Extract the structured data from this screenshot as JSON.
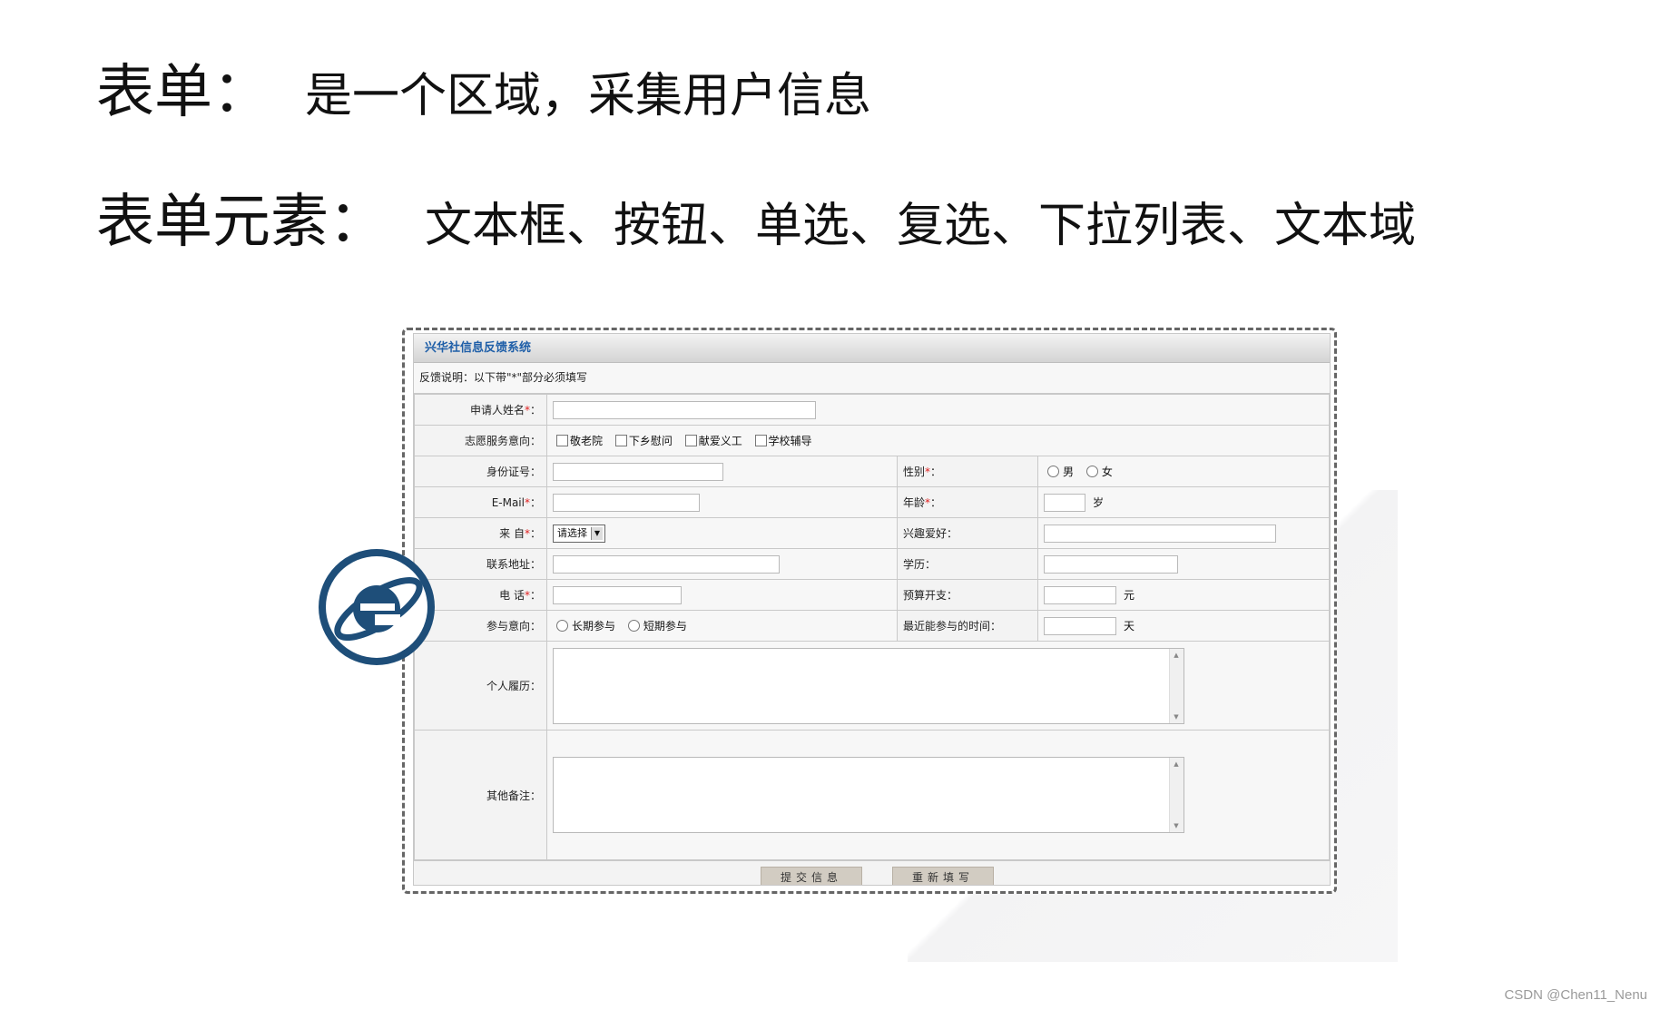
{
  "slide": {
    "line1": {
      "label": "表单：",
      "text": "是一个区域，采集用户信息"
    },
    "line2": {
      "label": "表单元素：",
      "text": "文本框、按钮、单选、复选、下拉列表、文本域"
    },
    "credit": "CSDN @Chen11_Nenu"
  },
  "form": {
    "title": "兴华社信息反馈系统",
    "note": "反馈说明：以下带\"*\"部分必须填写",
    "required_mark": "*",
    "applicant_label": "申请人姓名",
    "volunteer_label": "志愿服务意向",
    "volunteer_options": [
      "敬老院",
      "下乡慰问",
      "献爱义工",
      "学校辅导"
    ],
    "id_label": "身份证号",
    "gender_label": "性别",
    "gender_options": [
      "男",
      "女"
    ],
    "email_label": "E-Mail",
    "age_label": "年龄",
    "age_unit": "岁",
    "from_label": "来 自",
    "from_select": "请选择",
    "hobby_label": "兴趣爱好",
    "address_label": "联系地址",
    "edu_label": "学历",
    "phone_label": "电 话",
    "budget_label": "预算开支",
    "budget_unit": "元",
    "intent_label": "参与意向",
    "intent_options": [
      "长期参与",
      "短期参与"
    ],
    "recent_label": "最近能参与的时间",
    "recent_unit": "天",
    "resume_label": "个人履历",
    "remarks_label": "其他备注",
    "submit_label": "提交信息",
    "reset_label": "重新填写"
  },
  "icons": {
    "browser": "internet-explorer-icon"
  },
  "colors": {
    "title_blue": "#1f5fa8",
    "required_red": "#e02020",
    "ie_blue": "#1e4e79"
  }
}
